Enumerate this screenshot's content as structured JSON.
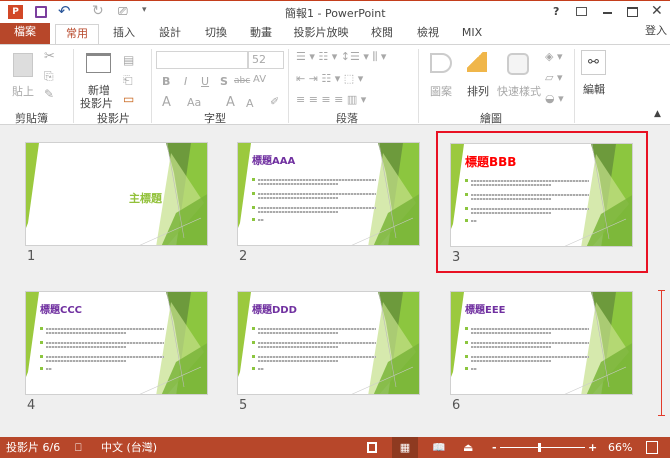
{
  "window": {
    "title": "簡報1 - PowerPoint",
    "help": "?",
    "signin": "登入"
  },
  "qat": {
    "save": "save-icon",
    "undo": "undo-icon",
    "redo": "redo-icon",
    "present": "present-icon"
  },
  "tabs": [
    {
      "label": "檔案"
    },
    {
      "label": "常用"
    },
    {
      "label": "插入"
    },
    {
      "label": "設計"
    },
    {
      "label": "切換"
    },
    {
      "label": "動畫"
    },
    {
      "label": "投影片放映"
    },
    {
      "label": "校閱"
    },
    {
      "label": "檢視"
    },
    {
      "label": "MIX"
    }
  ],
  "ribbon": {
    "paste": "貼上",
    "clipboard": "剪貼簿",
    "new_slide_1": "新增",
    "new_slide_2": "投影片",
    "slides": "投影片",
    "font_size": "52",
    "font": "字型",
    "bold": "B",
    "italic": "I",
    "underline": "U",
    "shadow": "S",
    "strike": "abc",
    "spacing": "AV",
    "font_color": "A",
    "case": "Aa",
    "grow": "A",
    "shrink": "A",
    "paragraph": "段落",
    "shapes": "圖案",
    "arrange": "排列",
    "quick_styles": "快速樣式",
    "drawing": "繪圖",
    "editing": "編輯"
  },
  "slides": [
    {
      "number": "1",
      "title": "主標題",
      "type": "title",
      "selected": false
    },
    {
      "number": "2",
      "title": "標題AAA",
      "type": "content",
      "selected": false
    },
    {
      "number": "3",
      "title": "標題BBB",
      "type": "content",
      "selected": true
    },
    {
      "number": "4",
      "title": "標題CCC",
      "type": "content",
      "selected": false
    },
    {
      "number": "5",
      "title": "標題DDD",
      "type": "content",
      "selected": false
    },
    {
      "number": "6",
      "title": "標題EEE",
      "type": "content",
      "selected": false
    }
  ],
  "colors": {
    "accent": "#b7472a",
    "title_purple": "#7030a0",
    "title_red": "#ff0000",
    "title_green": "#92c13a",
    "selection": "#e81123"
  },
  "status": {
    "slide_count": "投影片 6/6",
    "language": "中文 (台灣)",
    "zoom": "66%",
    "zoom_level": 66,
    "minus": "-",
    "plus": "+"
  }
}
